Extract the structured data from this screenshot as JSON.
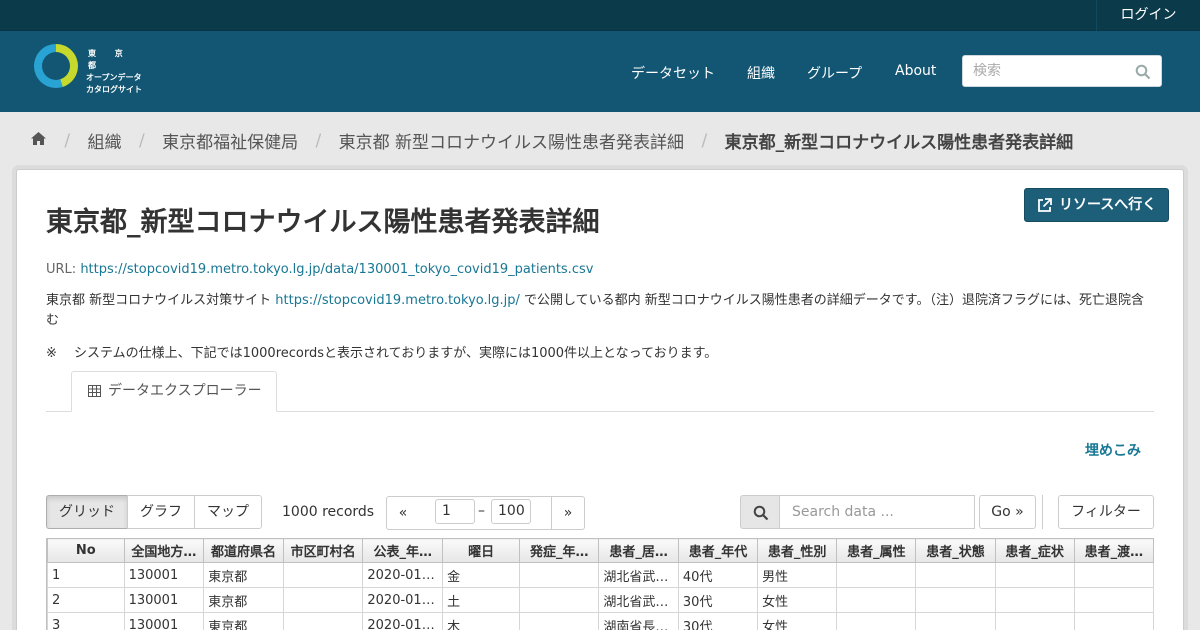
{
  "account": {
    "login_label": "ログイン"
  },
  "site": {
    "logo_lines": [
      "東 京 都",
      "オープンデータ",
      "カタログサイト"
    ],
    "nav": [
      {
        "label": "データセット"
      },
      {
        "label": "組織"
      },
      {
        "label": "グループ"
      },
      {
        "label": "About"
      }
    ],
    "search_placeholder": "検索"
  },
  "breadcrumb": {
    "home_icon": "home-icon",
    "items": [
      {
        "label": "組織"
      },
      {
        "label": "東京都福祉保健局"
      },
      {
        "label": "東京都 新型コロナウイルス陽性患者発表詳細"
      },
      {
        "label": "東京都_新型コロナウイルス陽性患者発表詳細"
      }
    ]
  },
  "resource": {
    "title": "東京都_新型コロナウイルス陽性患者発表詳細",
    "go_button_label": "リソースへ行く",
    "url_label": "URL:",
    "url": "https://stopcovid19.metro.tokyo.lg.jp/data/130001_tokyo_covid19_patients.csv",
    "description_prefix": "東京都 新型コロナウイルス対策サイト",
    "description_link": "https://stopcovid19.metro.tokyo.lg.jp/",
    "description_suffix": "で公開している都内 新型コロナウイルス陽性患者の詳細データです。（注）退院済フラグには、死亡退院含む",
    "note_mark": "※",
    "note_text": "システムの仕様上、下記では1000recordsと表示されておりますが、実際には1000件以上となっております。"
  },
  "explorer": {
    "tab_label": "データエクスプローラー",
    "embed_label": "埋めこみ",
    "views": [
      {
        "label": "グリッド",
        "active": true
      },
      {
        "label": "グラフ",
        "active": false
      },
      {
        "label": "マップ",
        "active": false
      }
    ],
    "records_text": "1000 records",
    "prev_label": "«",
    "next_label": "»",
    "page_from": "1",
    "page_to": "100",
    "range_sep": "–",
    "search_placeholder": "Search data ...",
    "go_label": "Go »",
    "filter_label": "フィルター"
  },
  "grid": {
    "columns": [
      "No",
      "全国地方…",
      "都道府県名",
      "市区町村名",
      "公表_年…",
      "曜日",
      "発症_年…",
      "患者_居…",
      "患者_年代",
      "患者_性別",
      "患者_属性",
      "患者_状態",
      "患者_症状",
      "患者_渡…"
    ],
    "rows": [
      [
        "1",
        "130001",
        "東京都",
        "",
        "2020-01…",
        "金",
        "",
        "湖北省武…",
        "40代",
        "男性",
        "",
        "",
        "",
        ""
      ],
      [
        "2",
        "130001",
        "東京都",
        "",
        "2020-01…",
        "土",
        "",
        "湖北省武…",
        "30代",
        "女性",
        "",
        "",
        "",
        ""
      ],
      [
        "3",
        "130001",
        "東京都",
        "",
        "2020-01…",
        "木",
        "",
        "湖南省長…",
        "30代",
        "女性",
        "",
        "",
        "",
        ""
      ]
    ]
  },
  "colors": {
    "masthead": "#125673",
    "account_bar": "#0b3a4b",
    "link": "#187794",
    "button": "#1d5e79"
  }
}
